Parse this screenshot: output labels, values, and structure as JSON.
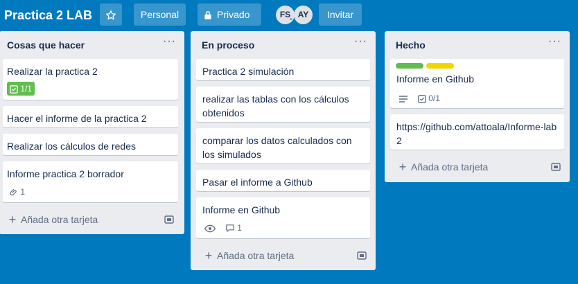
{
  "header": {
    "board_title": "Practica 2 LAB",
    "personal_label": "Personal",
    "privado_label": "Privado",
    "members": [
      "FS",
      "AY"
    ],
    "invite_label": "Invitar"
  },
  "lists": [
    {
      "title": "Cosas que hacer",
      "menu": "···",
      "cards": [
        {
          "title": "Realizar la practica 2",
          "checklist": "1/1"
        },
        {
          "title": "Hacer el informe de la practica 2"
        },
        {
          "title": "Realizar los cálculos de redes"
        },
        {
          "title": "Informe practica 2 borrador",
          "attachments": "1"
        }
      ],
      "add_label": "Añada otra tarjeta"
    },
    {
      "title": "En proceso",
      "menu": "···",
      "cards": [
        {
          "title": "Practica 2 simulación"
        },
        {
          "title": "realizar las tablas con los cálculos obtenidos"
        },
        {
          "title": "comparar los datos calculados con los simulados"
        },
        {
          "title": "Pasar el informe a Github"
        },
        {
          "title": "Informe en Github",
          "comments": "1"
        }
      ],
      "add_label": "Añada otra tarjeta"
    },
    {
      "title": "Hecho",
      "menu": "···",
      "cards": [
        {
          "title": "Informe en Github",
          "checklist": "0/1",
          "labels": [
            "#61bd4f",
            "#f2d600"
          ]
        },
        {
          "title": "https://github.com/attoala/Informe-lab2"
        }
      ],
      "add_label": "Añada otra tarjeta"
    }
  ],
  "colors": {
    "board_background": "#0079bf",
    "list_background": "#ebecf0",
    "checklist_complete": "#61bd4f",
    "label_green": "#61bd4f",
    "label_yellow": "#f2d600"
  }
}
